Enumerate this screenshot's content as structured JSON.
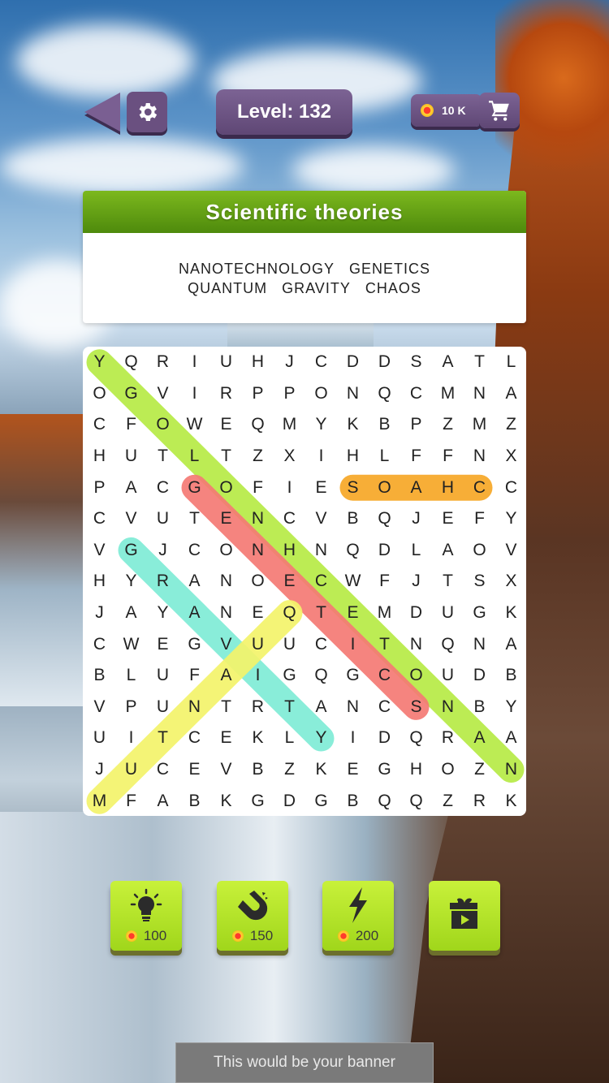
{
  "header": {
    "level_label": "Level: 132",
    "coins": "10 K"
  },
  "icons": {
    "back": "back-arrow-icon",
    "settings": "gear-icon",
    "coin": "coin-icon",
    "shop": "cart-icon"
  },
  "category": {
    "title": "Scientific theories",
    "words_row1": [
      "NANOTECHNOLOGY",
      "GENETICS"
    ],
    "words_row2": [
      "QUANTUM",
      "GRAVITY",
      "CHAOS"
    ]
  },
  "grid": {
    "rows": [
      "YQRIUHJCDDSATL",
      "OGVIRPPONQCMNA",
      "CFOWEQMYKBPZMZ",
      "HUTLTZXIHLFFNX",
      "PACGOFIESOAHCC",
      "CVUTENCVBQJEFY",
      "VGJCONHNQDLAOV",
      "HYRANOECWFJTSX",
      "JAYANEQTEMDUGK",
      "CWEGVUUCITNQNA",
      "BLUFAIGQGCOUDB",
      "VPUNTRTANCSNBY",
      "UITCEKLYIDQRAA",
      "JUCEVBZKEGHOZN",
      "MFABKGDGBQQZRK"
    ],
    "highlights": [
      {
        "word": "NANOTECHNOLOGY",
        "from": [
          13,
          13
        ],
        "to": [
          0,
          0
        ],
        "color": "#b6ea45"
      },
      {
        "word": "GENETICS",
        "from": [
          4,
          3
        ],
        "to": [
          11,
          10
        ],
        "color": "#f47a74"
      },
      {
        "word": "CHAOS",
        "from": [
          4,
          12
        ],
        "to": [
          4,
          8
        ],
        "color": "#f6a726"
      },
      {
        "word": "GRAVITY",
        "from": [
          6,
          1
        ],
        "to": [
          12,
          7
        ],
        "color": "#7fecd6"
      },
      {
        "word": "QUANTUM",
        "from": [
          8,
          6
        ],
        "to": [
          14,
          0
        ],
        "color": "#f3f36a"
      }
    ]
  },
  "boosters": [
    {
      "name": "hint",
      "icon": "lightbulb-icon",
      "price": "100"
    },
    {
      "name": "magnet",
      "icon": "magnet-icon",
      "price": "150"
    },
    {
      "name": "lightning",
      "icon": "lightning-icon",
      "price": "200"
    },
    {
      "name": "video-gift",
      "icon": "gift-video-icon",
      "price": ""
    }
  ],
  "banner": {
    "text": "This would be your banner"
  }
}
